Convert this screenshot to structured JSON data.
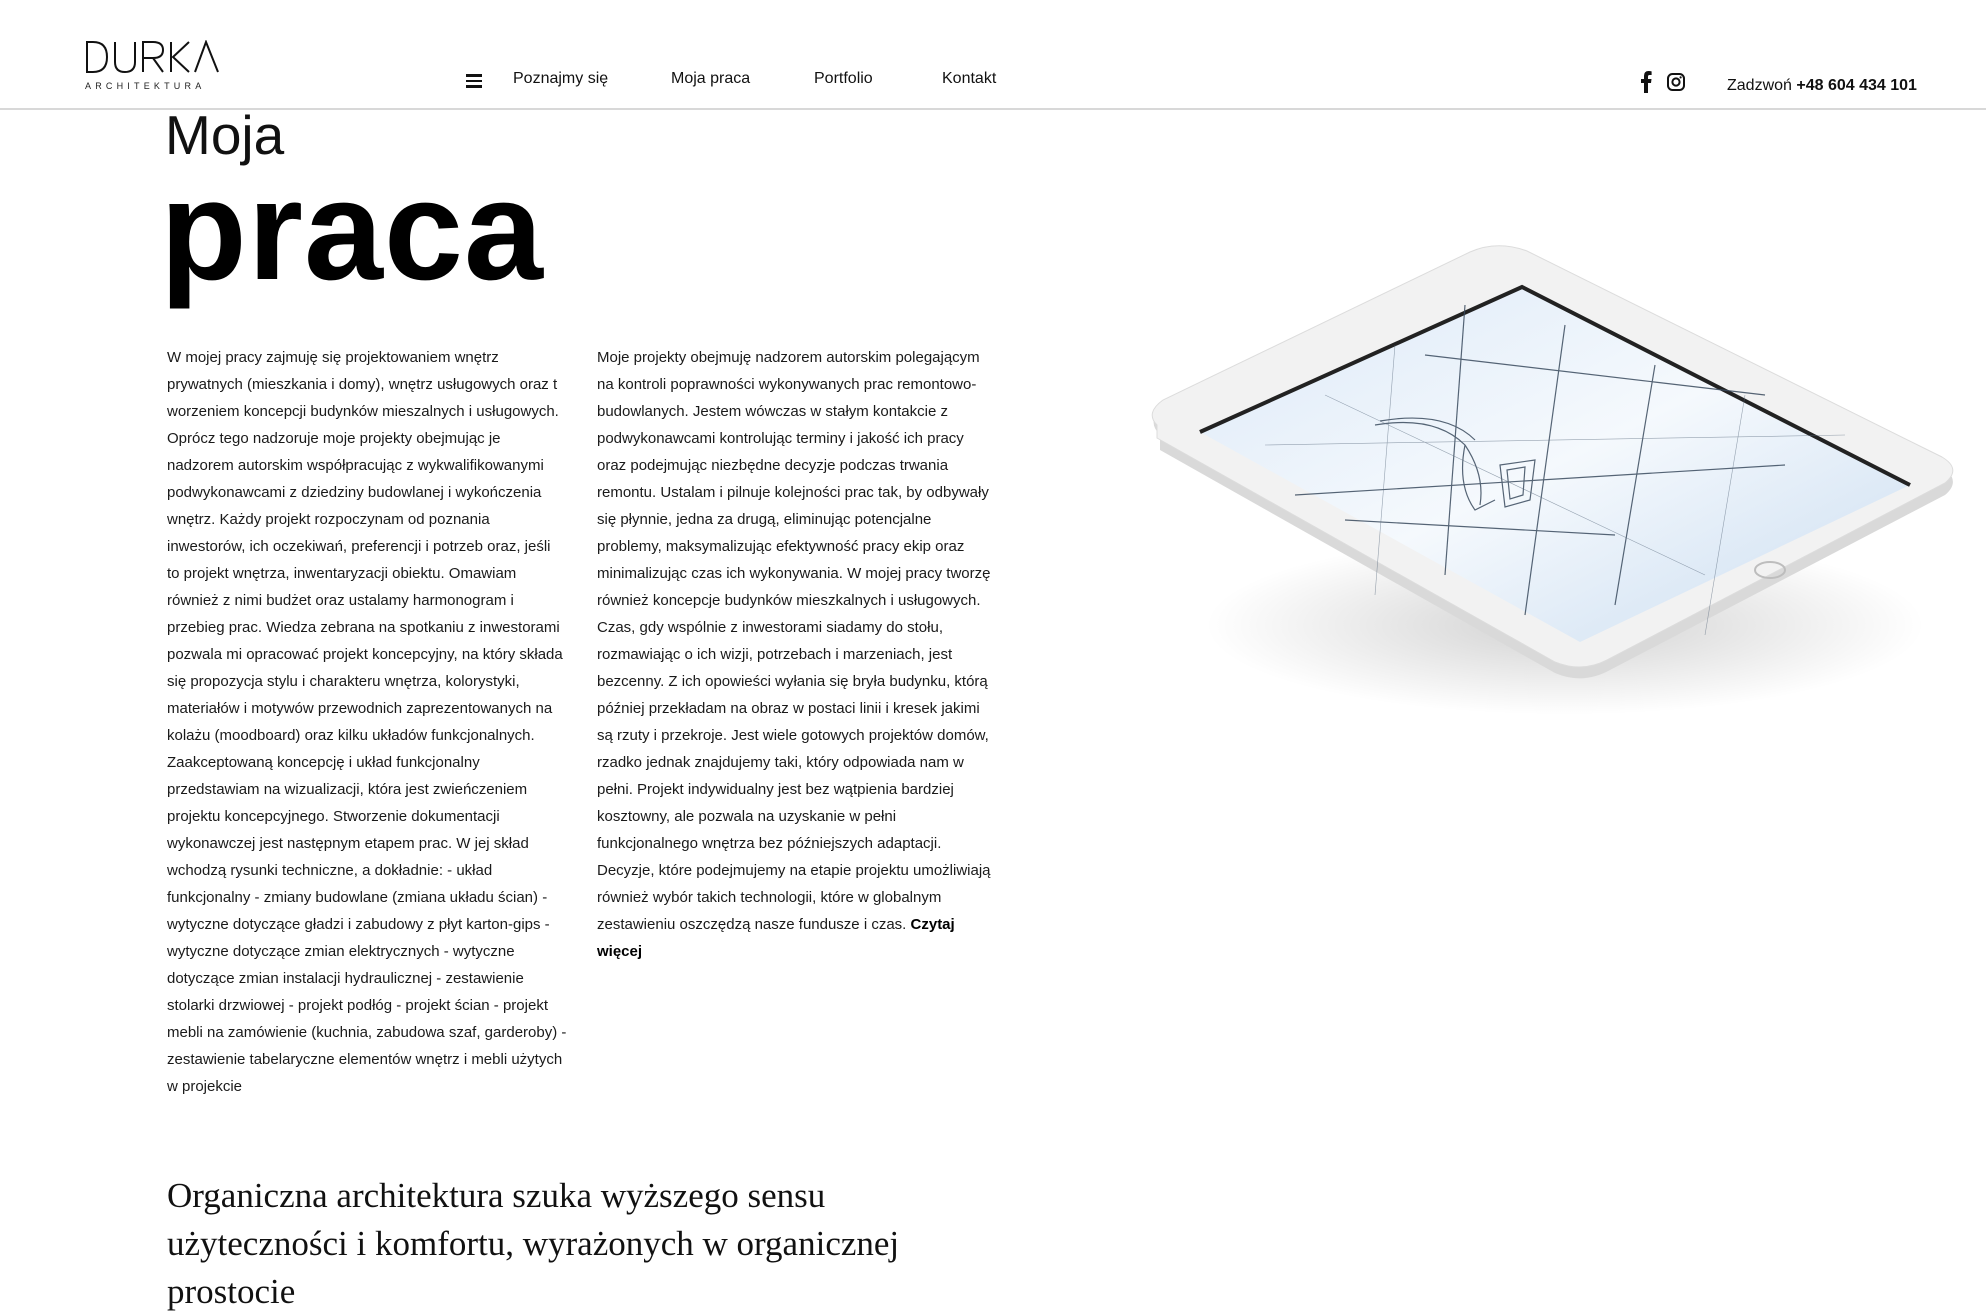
{
  "header": {
    "logo_text": "DURKA",
    "logo_subtitle": "ARCHITEKTURA",
    "nav": [
      "Poznajmy się",
      "Moja praca",
      "Portfolio",
      "Kontakt"
    ],
    "call_label": "Zadzwoń",
    "phone": "+48 604 434 101",
    "icons": [
      "menu-icon",
      "facebook-icon",
      "instagram-icon"
    ]
  },
  "hero": {
    "title_light": "Moja",
    "title_bold": "praca"
  },
  "columns": {
    "left_text": "W mojej pracy zajmuję się projektowaniem wnętrz prywatnych (mieszkania i domy), wnętrz usługowych oraz t worzeniem koncepcji budynków mieszalnych i usługowych. Oprócz tego nadzoruje moje projekty obejmując je nadzorem autorskim współpracując z wykwalifikowanymi podwykonawcami z dziedziny budowlanej i wykończenia wnętrz. Każdy projekt rozpoczynam od poznania inwestorów, ich oczekiwań, preferencji i potrzeb oraz, jeśli to projekt wnętrza, inwentaryzacji obiektu. Omawiam również z nimi budżet oraz ustalamy harmonogram i przebieg prac. Wiedza zebrana na spotkaniu z inwestorami pozwala mi opracować projekt koncepcyjny, na który składa się propozycja stylu i charakteru wnętrza, kolorystyki, materiałów i motywów przewodnich zaprezentowanych na kolażu (moodboard) oraz kilku układów funkcjonalnych. Zaakceptowaną koncepcję i układ funkcjonalny przedstawiam na wizualizacji, która jest zwieńczeniem projektu koncepcyjnego. Stworzenie dokumentacji wykonawczej jest następnym etapem prac. W jej skład wchodzą rysunki techniczne, a dokładnie: - układ funkcjonalny - zmiany budowlane (zmiana układu ścian) - wytyczne dotyczące gładzi i zabudowy z płyt karton-gips - wytyczne dotyczące zmian elektrycznych - wytyczne dotyczące zmian instalacji hydraulicznej - zestawienie stolarki drzwiowej - projekt podłóg - projekt ścian - projekt mebli na zamówienie (kuchnia, zabudowa szaf, garderoby) - zestawienie tabelaryczne elementów wnętrz i mebli użytych w projekcie",
    "right_text": "Moje projekty obejmuję nadzorem autorskim polegającym na kontroli poprawności wykonywanych prac remontowo-budowlanych. Jestem wówczas w stałym kontakcie z podwykonawcami kontrolując terminy i jakość ich pracy oraz podejmując niezbędne decyzje podczas trwania remontu. Ustalam i pilnuje kolejności prac tak, by odbywały się płynnie, jedna za drugą, eliminując potencjalne problemy, maksymalizując efektywność pracy ekip oraz minimalizując czas ich wykonywania. W mojej pracy tworzę również koncepcje budynków mieszkalnych i usługowych. Czas, gdy wspólnie z inwestorami siadamy do stołu, rozmawiając o ich wizji, potrzebach i marzeniach, jest bezcenny. Z ich opowieści wyłania się bryła budynku, którą później przekładam na obraz w postaci linii i kresek jakimi są rzuty i przekroje. Jest wiele gotowych projektów domów, rzadko jednak znajdujemy taki, który odpowiada nam w pełni. Projekt indywidualny jest bez wątpienia bardziej kosztowny, ale pozwala na uzyskanie w pełni funkcjonalnego wnętrza bez późniejszych adaptacji. Decyzje, które podejmujemy na etapie projektu umożliwiają również wybór takich technologii, które w globalnym zestawieniu oszczędzą nasze fundusze i czas.",
    "read_more": "Czytaj więcej"
  },
  "quote": "Organiczna architektura szuka wyższego sensu użyteczności i komfortu, wyrażonych w organicznej prostocie",
  "colors": {
    "text": "#111111",
    "header_border": "#d8d8d8",
    "tablet_frame": "#f1f1f1",
    "tablet_screen": "#e4eef8"
  }
}
